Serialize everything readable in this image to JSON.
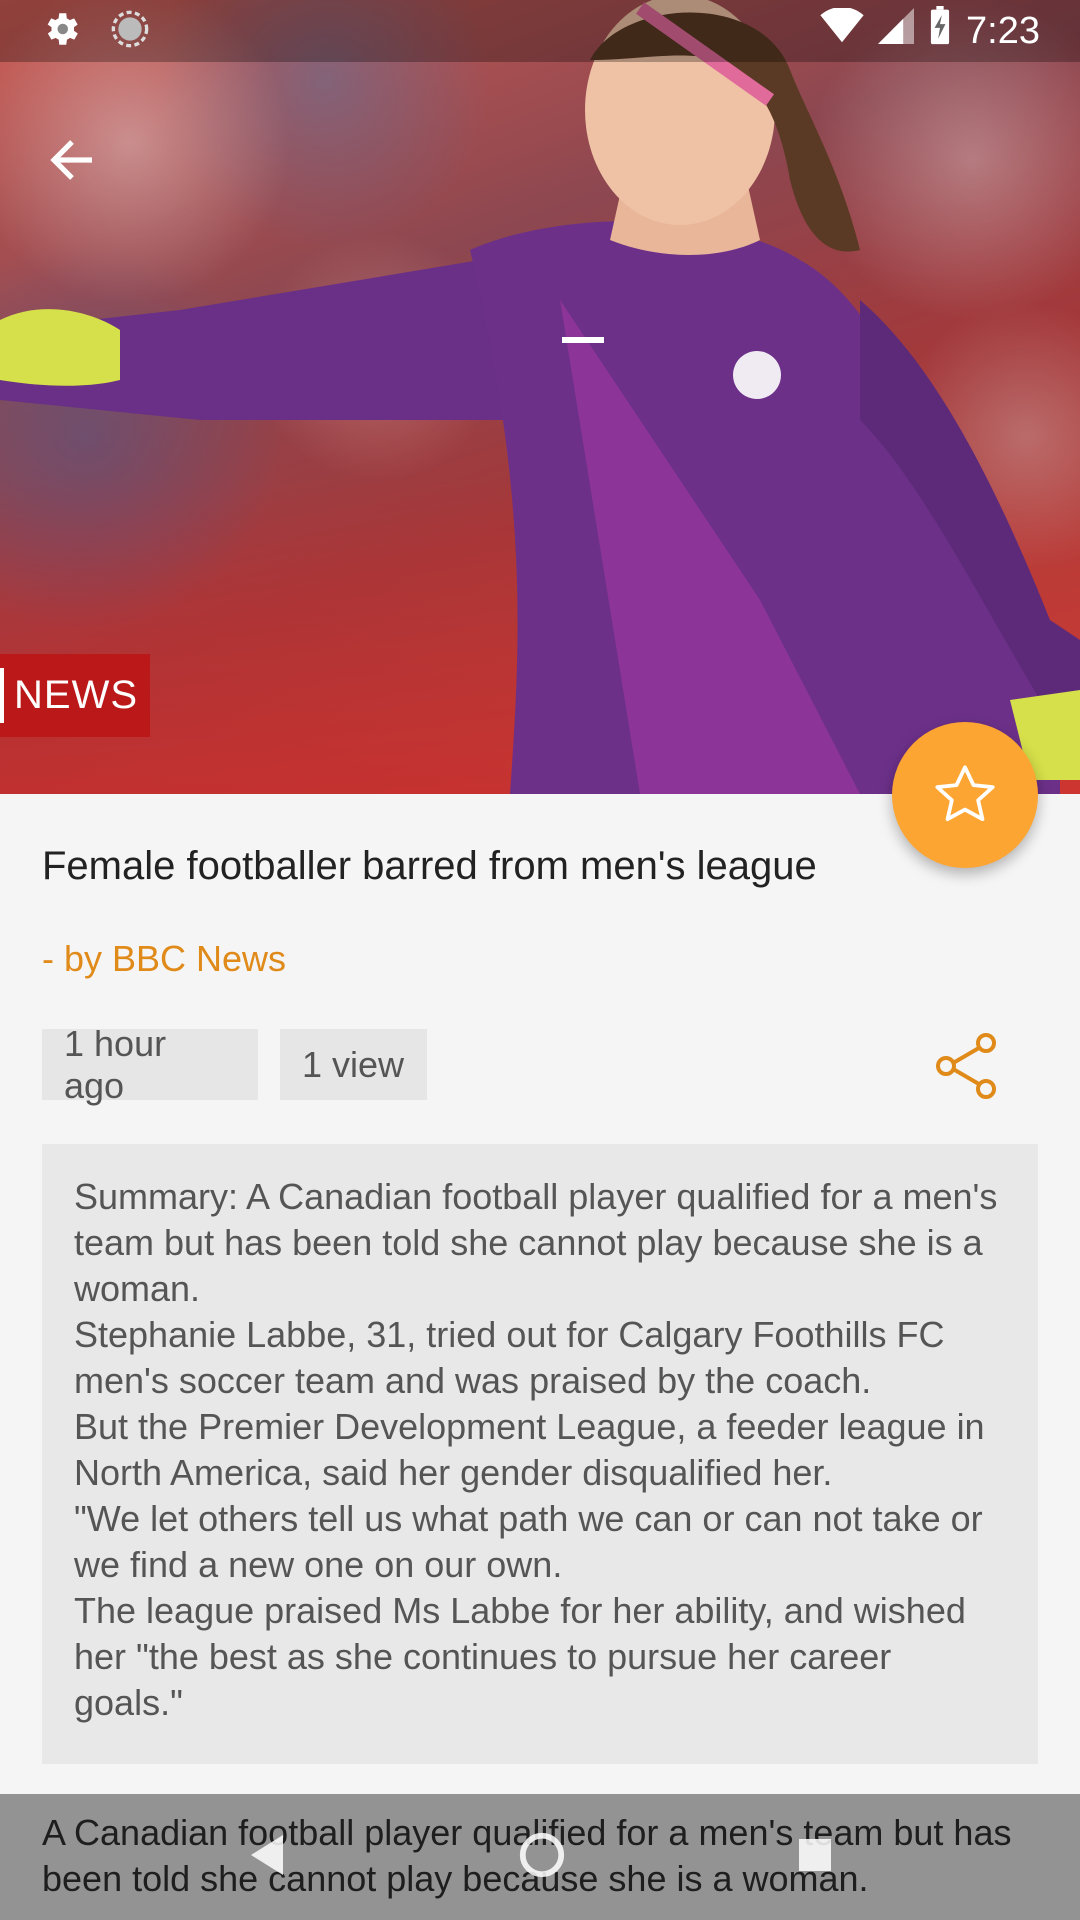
{
  "status_bar": {
    "time": "7:23",
    "left_icons": [
      "gear-icon",
      "sync-icon"
    ],
    "right_icons": [
      "wifi-icon",
      "signal-icon",
      "battery-charging-icon"
    ]
  },
  "hero": {
    "source_badge": "NEWS"
  },
  "article": {
    "title": "Female footballer barred from men's league",
    "author": "- by BBC News",
    "time_ago": "1 hour ago",
    "views": "1 view",
    "summary": [
      "Summary: A Canadian football player qualified for a men's team but has been told she cannot play because she is a woman.",
      "Stephanie Labbe, 31, tried out for Calgary Foothills FC men's soccer team and was praised by the coach.",
      "But the Premier Development League, a feeder league in North America, said her gender disqualified her.",
      "\"We let others tell us what path we can or can not take or we find a new one on our own.",
      "The league praised Ms Labbe for her ability, and wished her \"the best as she continues to pursue her career goals.\""
    ],
    "body": "A Canadian football player qualified for a men's team but has been told she cannot play because she is a woman."
  },
  "colors": {
    "accent": "#fda532",
    "author": "#e08a1a",
    "news_red": "#bb1919",
    "chip_bg": "#e6e6e6",
    "summary_bg": "#e8e8e8"
  }
}
